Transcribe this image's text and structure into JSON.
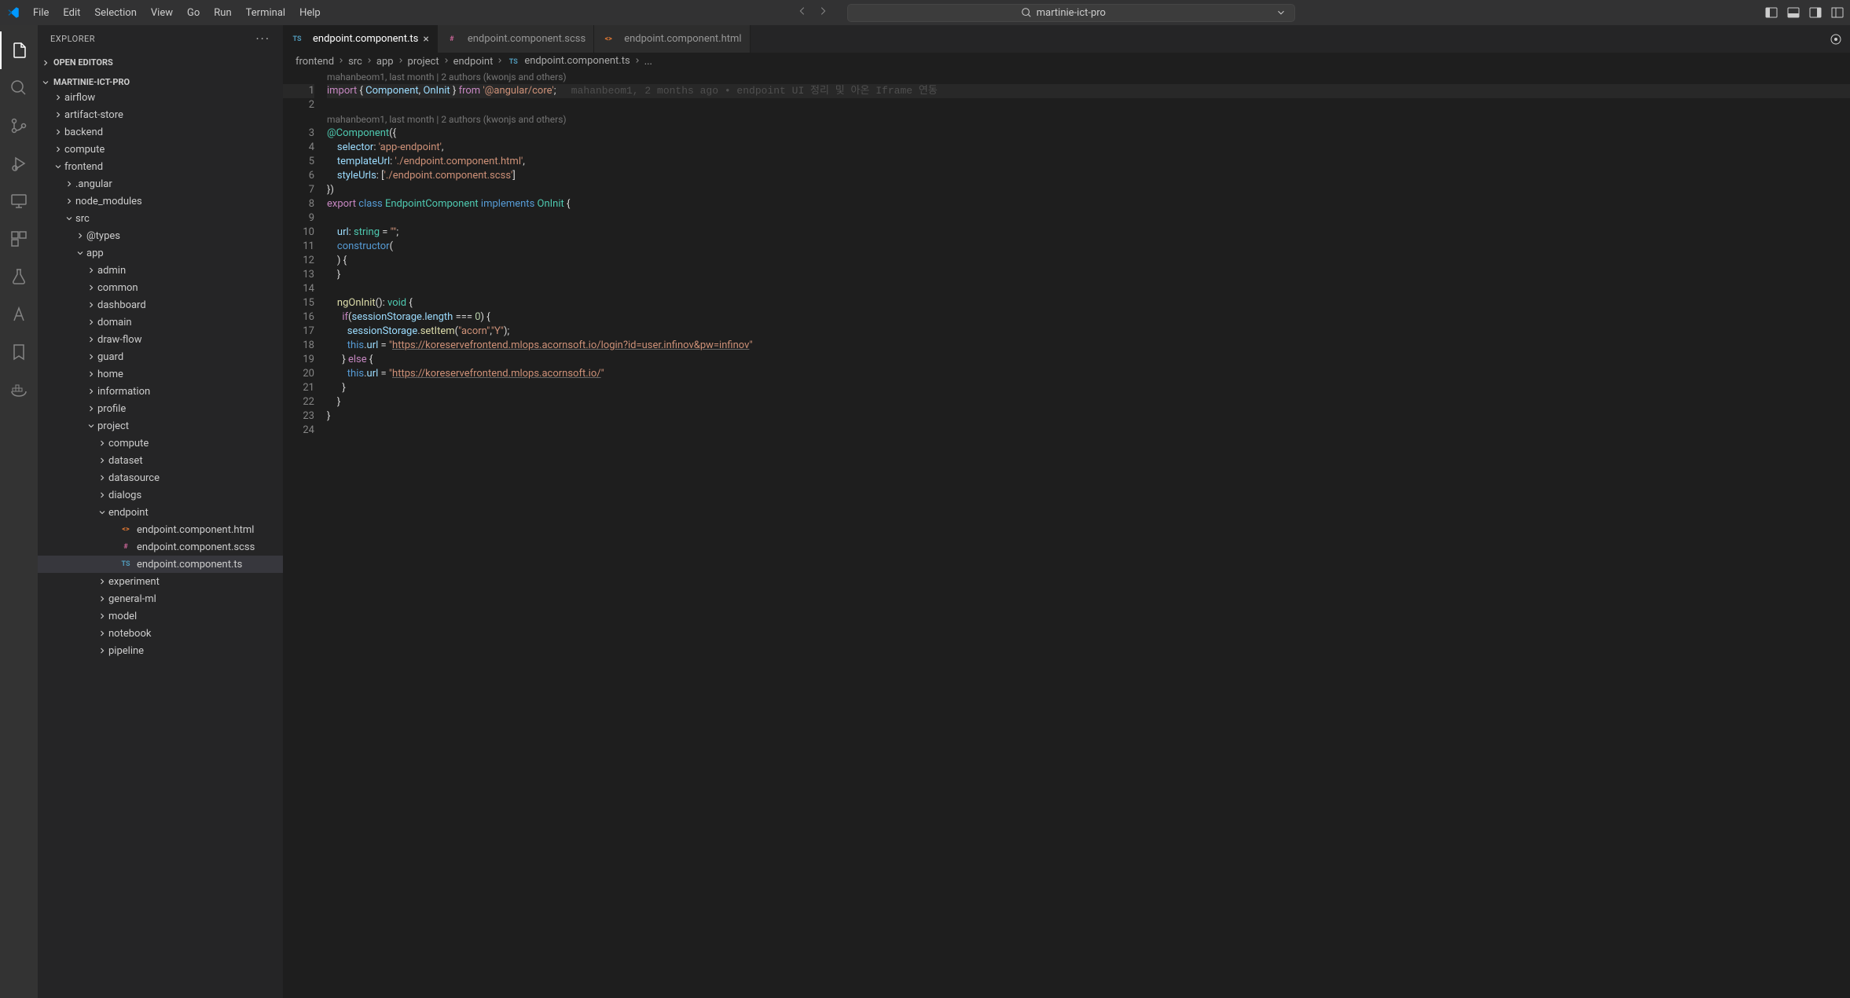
{
  "menu": [
    "File",
    "Edit",
    "Selection",
    "View",
    "Go",
    "Run",
    "Terminal",
    "Help"
  ],
  "search": {
    "placeholder": "martinie-ict-pro"
  },
  "sidebar": {
    "title": "EXPLORER",
    "sections": {
      "open_editors": "OPEN EDITORS",
      "project": "MARTINIE-ICT-PRO"
    },
    "tree": [
      {
        "label": "airflow",
        "type": "folder",
        "indent": 1,
        "expanded": false
      },
      {
        "label": "artifact-store",
        "type": "folder",
        "indent": 1,
        "expanded": false
      },
      {
        "label": "backend",
        "type": "folder",
        "indent": 1,
        "expanded": false
      },
      {
        "label": "compute",
        "type": "folder",
        "indent": 1,
        "expanded": false
      },
      {
        "label": "frontend",
        "type": "folder",
        "indent": 1,
        "expanded": true
      },
      {
        "label": ".angular",
        "type": "folder",
        "indent": 2,
        "expanded": false
      },
      {
        "label": "node_modules",
        "type": "folder",
        "indent": 2,
        "expanded": false
      },
      {
        "label": "src",
        "type": "folder",
        "indent": 2,
        "expanded": true
      },
      {
        "label": "@types",
        "type": "folder",
        "indent": 3,
        "expanded": false
      },
      {
        "label": "app",
        "type": "folder",
        "indent": 3,
        "expanded": true
      },
      {
        "label": "admin",
        "type": "folder",
        "indent": 4,
        "expanded": false
      },
      {
        "label": "common",
        "type": "folder",
        "indent": 4,
        "expanded": false
      },
      {
        "label": "dashboard",
        "type": "folder",
        "indent": 4,
        "expanded": false
      },
      {
        "label": "domain",
        "type": "folder",
        "indent": 4,
        "expanded": false
      },
      {
        "label": "draw-flow",
        "type": "folder",
        "indent": 4,
        "expanded": false
      },
      {
        "label": "guard",
        "type": "folder",
        "indent": 4,
        "expanded": false
      },
      {
        "label": "home",
        "type": "folder",
        "indent": 4,
        "expanded": false
      },
      {
        "label": "information",
        "type": "folder",
        "indent": 4,
        "expanded": false
      },
      {
        "label": "profile",
        "type": "folder",
        "indent": 4,
        "expanded": false
      },
      {
        "label": "project",
        "type": "folder",
        "indent": 4,
        "expanded": true
      },
      {
        "label": "compute",
        "type": "folder",
        "indent": 5,
        "expanded": false
      },
      {
        "label": "dataset",
        "type": "folder",
        "indent": 5,
        "expanded": false
      },
      {
        "label": "datasource",
        "type": "folder",
        "indent": 5,
        "expanded": false
      },
      {
        "label": "dialogs",
        "type": "folder",
        "indent": 5,
        "expanded": false
      },
      {
        "label": "endpoint",
        "type": "folder",
        "indent": 5,
        "expanded": true
      },
      {
        "label": "endpoint.component.html",
        "type": "file",
        "indent": 6,
        "fileType": "html"
      },
      {
        "label": "endpoint.component.scss",
        "type": "file",
        "indent": 6,
        "fileType": "scss"
      },
      {
        "label": "endpoint.component.ts",
        "type": "file",
        "indent": 6,
        "fileType": "ts",
        "selected": true
      },
      {
        "label": "experiment",
        "type": "folder",
        "indent": 5,
        "expanded": false
      },
      {
        "label": "general-ml",
        "type": "folder",
        "indent": 5,
        "expanded": false
      },
      {
        "label": "model",
        "type": "folder",
        "indent": 5,
        "expanded": false
      },
      {
        "label": "notebook",
        "type": "folder",
        "indent": 5,
        "expanded": false
      },
      {
        "label": "pipeline",
        "type": "folder",
        "indent": 5,
        "expanded": false
      }
    ]
  },
  "tabs": [
    {
      "label": "endpoint.component.ts",
      "fileType": "ts",
      "active": true,
      "close": true
    },
    {
      "label": "endpoint.component.scss",
      "fileType": "scss",
      "active": false,
      "close": false
    },
    {
      "label": "endpoint.component.html",
      "fileType": "html",
      "active": false,
      "close": false
    }
  ],
  "breadcrumbs": [
    "frontend",
    "src",
    "app",
    "project",
    "endpoint",
    "endpoint.component.ts",
    "..."
  ],
  "breadcrumb_file_type": "ts",
  "code": {
    "codelens1": "mahanbeom1, last month | 2 authors (kwonjs and others)",
    "blame1": "mahanbeom1, 2 months ago • endpoint UI 정리 및 아온 Iframe 연동",
    "codelens2": "mahanbeom1, last month | 2 authors (kwonjs and others)",
    "lines": [
      {
        "n": 1,
        "html": "<span class='kw'>import</span> <span class='punct'>{</span> <span class='obj'>Component</span><span class='punct'>,</span> <span class='obj'>OnInit</span> <span class='punct'>}</span> <span class='kw'>from</span> <span class='str'>'@angular/core'</span><span class='punct'>;</span>"
      },
      {
        "n": 2,
        "html": ""
      },
      {
        "n": 3,
        "html": "<span class='decorator'>@Component</span><span class='punct'>({</span>"
      },
      {
        "n": 4,
        "html": "    <span class='prop'>selector</span><span class='punct'>:</span> <span class='str'>'app-endpoint'</span><span class='punct'>,</span>"
      },
      {
        "n": 5,
        "html": "    <span class='prop'>templateUrl</span><span class='punct'>:</span> <span class='str'>'./endpoint.component.html'</span><span class='punct'>,</span>"
      },
      {
        "n": 6,
        "html": "    <span class='prop'>styleUrls</span><span class='punct'>:</span> <span class='punct'>[</span><span class='str'>'./endpoint.component.scss'</span><span class='punct'>]</span>"
      },
      {
        "n": 7,
        "html": "<span class='punct'>})</span>"
      },
      {
        "n": 8,
        "html": "<span class='kw'>export</span> <span class='kw2'>class</span> <span class='type'>EndpointComponent</span> <span class='kw2'>implements</span> <span class='type'>OnInit</span> <span class='punct'>{</span>"
      },
      {
        "n": 9,
        "html": ""
      },
      {
        "n": 10,
        "html": "    <span class='prop'>url</span><span class='punct'>:</span> <span class='type'>string</span> <span class='punct'>=</span> <span class='str'>\"\"</span><span class='punct'>;</span>"
      },
      {
        "n": 11,
        "html": "    <span class='kw2'>constructor</span><span class='punct'>(</span>"
      },
      {
        "n": 12,
        "html": "    <span class='punct'>) {</span>"
      },
      {
        "n": 13,
        "html": "    <span class='punct'>}</span>"
      },
      {
        "n": 14,
        "html": ""
      },
      {
        "n": 15,
        "html": "    <span class='fn'>ngOnInit</span><span class='punct'>():</span> <span class='type'>void</span> <span class='punct'>{</span>"
      },
      {
        "n": 16,
        "html": "      <span class='kw'>if</span><span class='punct'>(</span><span class='obj'>sessionStorage</span><span class='punct'>.</span><span class='prop'>length</span> <span class='punct'>===</span> <span class='num'>0</span><span class='punct'>) {</span>"
      },
      {
        "n": 17,
        "html": "        <span class='obj'>sessionStorage</span><span class='punct'>.</span><span class='fn'>setItem</span><span class='punct'>(</span><span class='str'>\"acorn\"</span><span class='punct'>,</span><span class='str'>\"Y\"</span><span class='punct'>);</span>"
      },
      {
        "n": 18,
        "html": "        <span class='this'>this</span><span class='punct'>.</span><span class='prop'>url</span> <span class='punct'>=</span> <span class='str'>\"</span><span class='underline-str'>https://koreservefrontend.mlops.acornsoft.io/login?id=user.infinov&pw=infinov</span><span class='str'>\"</span>"
      },
      {
        "n": 19,
        "html": "      <span class='punct'>}</span> <span class='kw'>else</span> <span class='punct'>{</span>"
      },
      {
        "n": 20,
        "html": "        <span class='this'>this</span><span class='punct'>.</span><span class='prop'>url</span> <span class='punct'>=</span> <span class='str'>\"</span><span class='underline-str'>https://koreservefrontend.mlops.acornsoft.io/</span><span class='str'>\"</span>"
      },
      {
        "n": 21,
        "html": "      <span class='punct'>}</span>"
      },
      {
        "n": 22,
        "html": "    <span class='punct'>}</span>"
      },
      {
        "n": 23,
        "html": "<span class='punct'>}</span>"
      },
      {
        "n": 24,
        "html": ""
      }
    ]
  }
}
